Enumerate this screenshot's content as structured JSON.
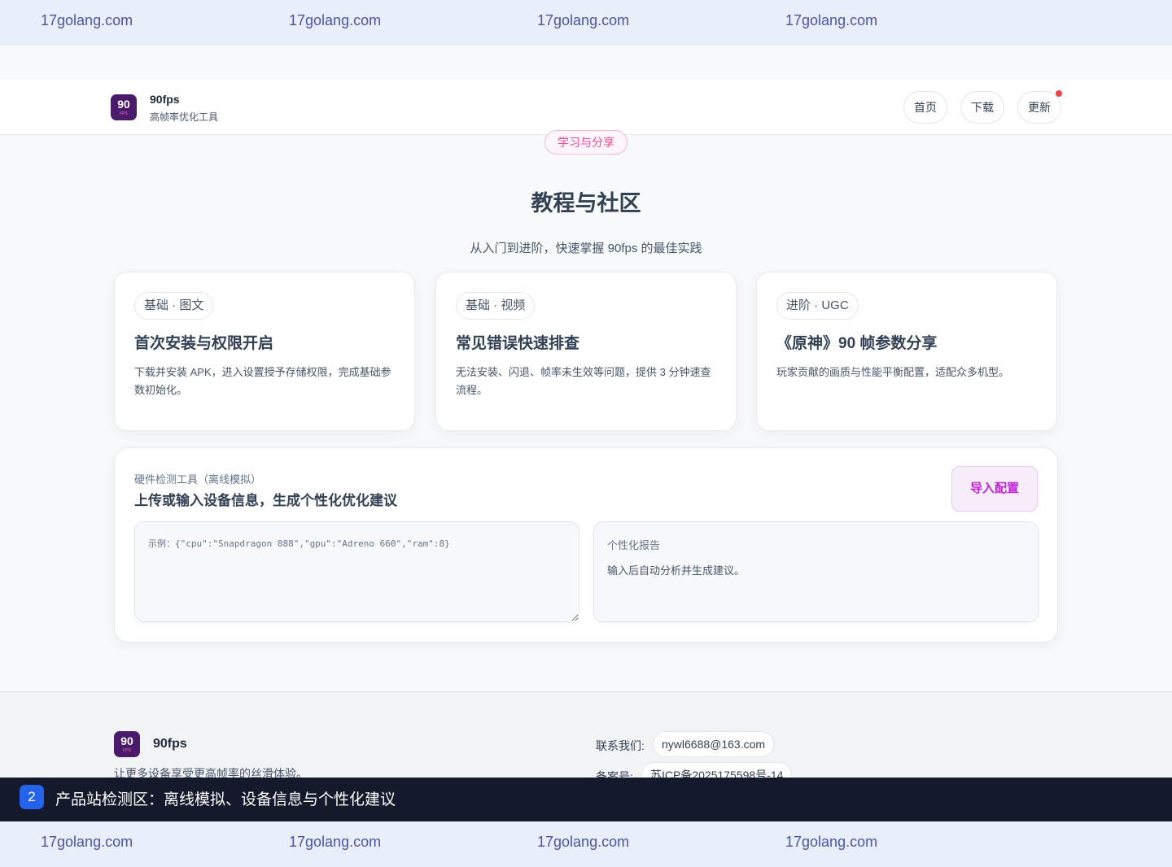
{
  "watermark": {
    "text": "17golang.com"
  },
  "header": {
    "logo": {
      "number": "90",
      "sub": "FPS"
    },
    "brand_name": "90fps",
    "brand_sub": "高帧率优化工具",
    "nav": [
      {
        "label": "首页"
      },
      {
        "label": "下载"
      },
      {
        "label": "更新"
      }
    ]
  },
  "section": {
    "pill": "学习与分享",
    "title": "教程与社区",
    "subtitle": "从入门到进阶，快速掌握 90fps 的最佳实践"
  },
  "cards": [
    {
      "tag": "基础 · 图文",
      "title": "首次安装与权限开启",
      "desc": "下载并安装 APK，进入设置授予存储权限，完成基础参数初始化。"
    },
    {
      "tag": "基础 · 视频",
      "title": "常见错误快速排查",
      "desc": "无法安装、闪退、帧率未生效等问题，提供 3 分钟速查流程。"
    },
    {
      "tag": "进阶 · UGC",
      "title": "《原神》90 帧参数分享",
      "desc": "玩家贡献的画质与性能平衡配置，适配众多机型。"
    }
  ],
  "tool": {
    "kicker": "硬件检测工具（离线模拟）",
    "heading": "上传或输入设备信息，生成个性化优化建议",
    "import_label": "导入配置",
    "input_placeholder": "示例：{\"cpu\":\"Snapdragon 888\",\"gpu\":\"Adreno 660\",\"ram\":8}",
    "input_value": "",
    "report_title": "个性化报告",
    "report_text": "输入后自动分析并生成建议。"
  },
  "footer": {
    "logo": {
      "number": "90",
      "sub": "FPS"
    },
    "brand": "90fps",
    "slogan": "让更多设备享受更高帧率的丝滑体验。",
    "contact_label": "联系我们:",
    "contact_value": "nywl6688@163.com",
    "icp_label": "备案号:",
    "icp_value": "苏ICP备2025175598号-14"
  },
  "caption": {
    "badge": "2",
    "text": "产品站检测区：离线模拟、设备信息与个性化建议"
  },
  "colors": {
    "accent_pink": "#ec4899",
    "accent_magenta": "#c026d3",
    "notification_dot": "#ef4444",
    "logo_bg": "#4a1a6b",
    "caption_bg": "#141a2c",
    "caption_badge": "#2563eb"
  }
}
